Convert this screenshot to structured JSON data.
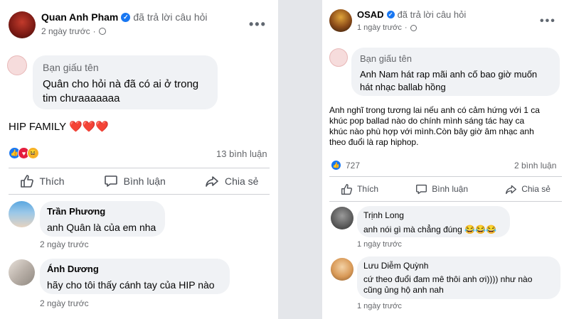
{
  "colors": {
    "verified": "#1877f2",
    "bubble": "#f0f2f5",
    "secondary_text": "#65676b",
    "heart": "#e41e3f",
    "like": "#1877f2",
    "care": "#f7b125"
  },
  "left": {
    "post": {
      "author": "Quan Anh Pham",
      "action": "đã trả lời câu hỏi",
      "time": "2 ngày trước",
      "more_icon": "more-horizontal-icon"
    },
    "question": {
      "name": "Bạn giấu tên",
      "text_line1": "Quân cho hỏi nà đã có ai ở trong",
      "text_line2": "tim chưaaaaaaa"
    },
    "answer": "HIP FAMILY ❤️❤️❤️",
    "comments_count": "13 bình luận",
    "actions": {
      "like": "Thích",
      "comment": "Bình luận",
      "share": "Chia sẻ"
    },
    "comments": [
      {
        "name": "Trần Phương",
        "text": "anh Quân là của em nha",
        "time": "2 ngày trước"
      },
      {
        "name": "Ánh Dương",
        "text": "hãy cho tôi thấy cánh tay của HIP nào",
        "time": "2 ngày trước"
      }
    ]
  },
  "right": {
    "post": {
      "author": "OSAD",
      "action": "đã trả lời câu hỏi",
      "time": "1 ngày trước",
      "more_icon": "more-horizontal-icon"
    },
    "question": {
      "name": "Bạn giấu tên",
      "text_line1": "Anh Nam hát rap mãi anh cố bao giờ muốn",
      "text_line2": "hát nhạc ballab hồng"
    },
    "answer": {
      "line1": "Anh nghĩ trong tương lai nếu anh có cảm hứng với 1 ca",
      "line2": "khúc pop ballad nào do chính mình sáng tác hay ca",
      "line3": "khúc nào phù hợp với mình.Còn bây giờ âm nhạc anh",
      "line4": "theo đuổi là rap hiphop."
    },
    "reactions_count": "727",
    "comments_count": "2 bình luận",
    "actions": {
      "like": "Thích",
      "comment": "Bình luận",
      "share": "Chia sẻ"
    },
    "comments": [
      {
        "name": "Trịnh Long",
        "text": "anh nói gì mà chẳng đúng 😂😂😂",
        "time": "1 ngày trước"
      },
      {
        "name": "Lưu Diễm Quỳnh",
        "text_line1": "cứ theo đuổi đam mê thôi anh ơi)))) như nào",
        "text_line2": "cũng ủng hộ anh nah",
        "time": "1 ngày trước"
      }
    ]
  }
}
